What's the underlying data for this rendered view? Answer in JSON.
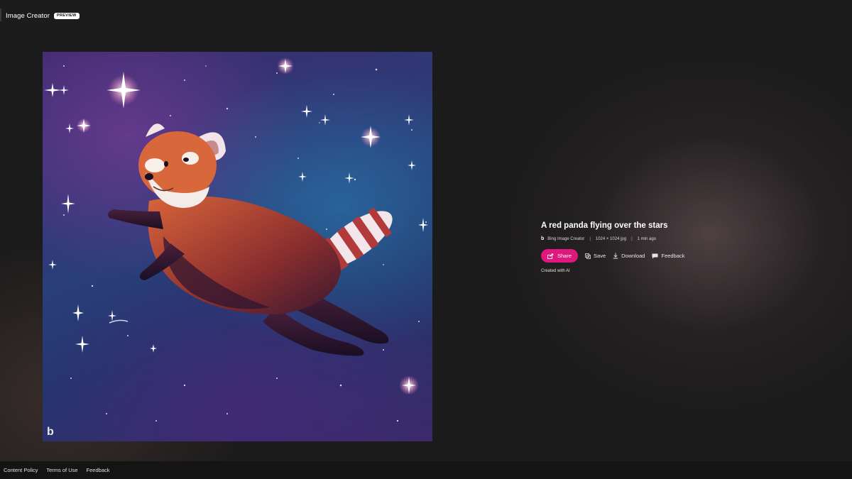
{
  "header": {
    "app_title": "Image Creator",
    "badge": "PREVIEW"
  },
  "image": {
    "description_icon": "red-panda-artwork",
    "watermark": "b"
  },
  "details": {
    "title": "A red panda flying over the stars",
    "source": "Bing Image Creator",
    "dimensions": "1024 × 1024 jpg",
    "time_ago": "1 min ago",
    "created_note": "Created with AI"
  },
  "actions": {
    "share": "Share",
    "save": "Save",
    "download": "Download",
    "feedback": "Feedback"
  },
  "footer": {
    "links": [
      "Content Policy",
      "Terms of Use",
      "Feedback"
    ]
  },
  "colors": {
    "accent": "#e0177d",
    "background": "#1c1b1b"
  }
}
